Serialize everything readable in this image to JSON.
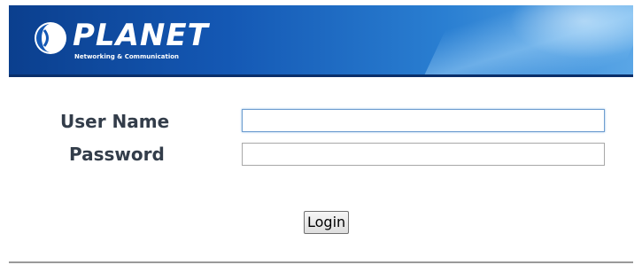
{
  "header": {
    "brand": "PLANET",
    "tagline": "Networking & Communication",
    "colors": {
      "banner_dark": "#0b3f8e",
      "banner_light": "#5aa6e6"
    }
  },
  "form": {
    "username_label": "User Name",
    "username_value": "",
    "password_label": "Password",
    "password_value": "",
    "login_label": "Login"
  }
}
